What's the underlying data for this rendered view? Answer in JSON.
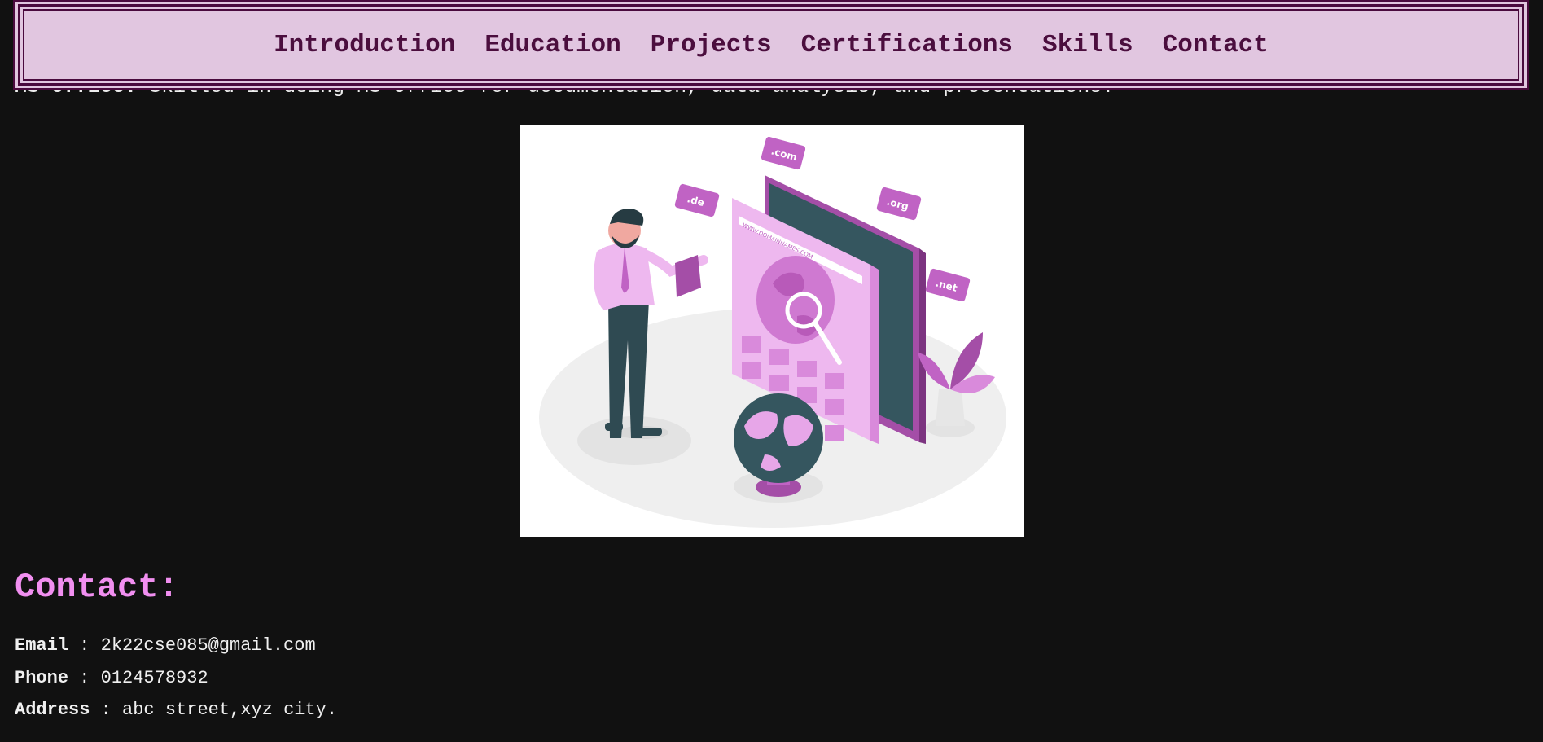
{
  "nav": {
    "items": [
      "Introduction",
      "Education",
      "Projects",
      "Certifications",
      "Skills",
      "Contact"
    ]
  },
  "skills": {
    "ms_office_label": "MS Office:",
    "ms_office_text": "Skilled in using MS Office for documentation, data analysis, and presentations."
  },
  "illustration": {
    "icon": "domain-search-illustration",
    "tags": [
      ".com",
      ".de",
      ".org",
      ".net"
    ],
    "url_text": "WWW.DOMAINNAMES.COM"
  },
  "contact": {
    "title": "Contact:",
    "email_label": "Email",
    "email": "2k22cse085@gmail.com",
    "phone_label": "Phone",
    "phone": "0124578932",
    "address_label": "Address",
    "address": "abc street,xyz city.",
    "separator": " : "
  },
  "colors": {
    "background": "#111111",
    "nav_bg": "#e1c6e0",
    "nav_text": "#4b0e3e",
    "accent": "#f18ff0",
    "illustration_purple": "#c063c4",
    "illustration_dark": "#2f4a52"
  }
}
